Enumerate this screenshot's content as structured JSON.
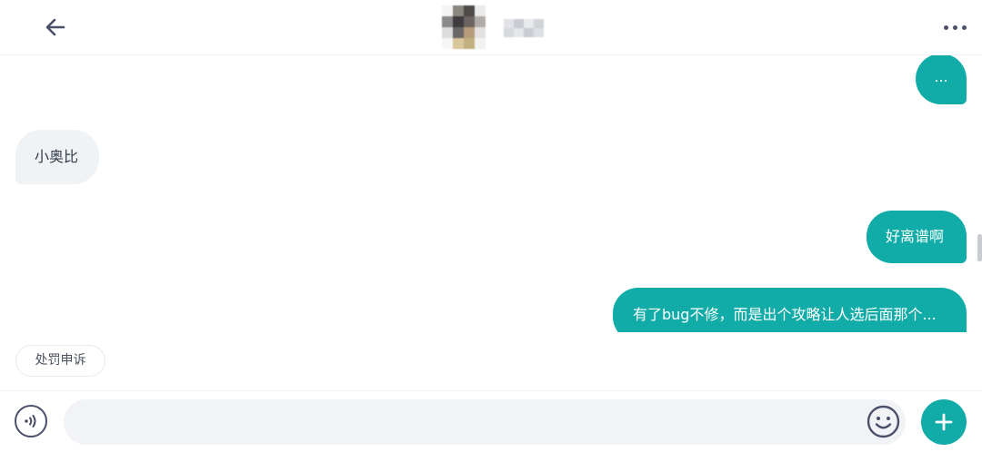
{
  "header": {
    "back_icon": "arrow-left-icon",
    "more_icon": "more-horizontal-icon",
    "avatar_pixels": [
      "#f4f4f4",
      "#8a8680",
      "#4e4a48",
      "#eaeaea",
      "#8c8a88",
      "#3e3c3e",
      "#6c6462",
      "#b0aaa8",
      "#dcdcdc",
      "#6a6866",
      "#b69c7a",
      "#e4e2e0",
      "#f6f6f6",
      "#d8c79a",
      "#c2b080",
      "#f2f2f2"
    ],
    "name_pixels": [
      "#e0e2e6",
      "#c8ccd2",
      "#e8eaed",
      "#d0d3d8",
      "#d6d9de",
      "#e4e6e9",
      "#caced4",
      "#dcdfe3"
    ]
  },
  "messages": [
    {
      "side": "me",
      "text": "..."
    },
    {
      "side": "other",
      "text": "小奥比"
    },
    {
      "side": "me",
      "text": "好离谱啊"
    },
    {
      "side": "me",
      "text": "有了bug不修，而是出个攻略让人选后面那个..."
    }
  ],
  "appeal_chip": {
    "label": "处罚申诉"
  },
  "input_bar": {
    "voice_icon": "voice-icon",
    "input_value": "",
    "input_placeholder": "",
    "emoji_icon": "emoji-icon",
    "plus_icon": "plus-icon"
  },
  "colors": {
    "accent": "#12aca8",
    "bubble_other": "#f0f3f6",
    "icon_dark": "#4a4f6a"
  }
}
